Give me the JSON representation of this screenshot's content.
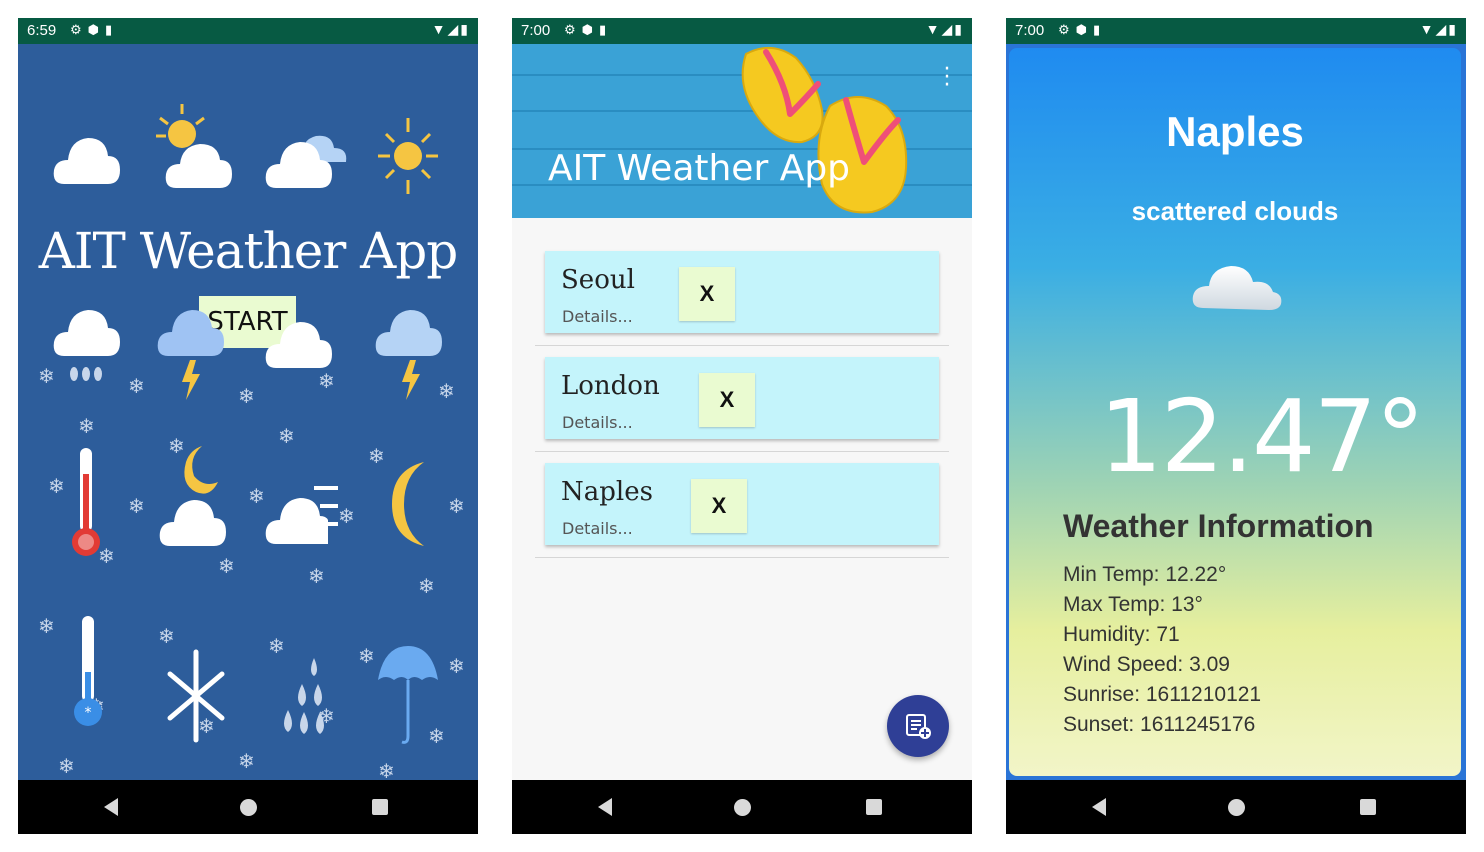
{
  "screen1": {
    "status": {
      "time": "6:59"
    },
    "title": "AIT Weather App",
    "start_label": "START"
  },
  "screen2": {
    "status": {
      "time": "7:00"
    },
    "appbar_title": "AIT Weather App",
    "cities": [
      {
        "name": "Seoul",
        "details": "Details...",
        "delete_label": "X"
      },
      {
        "name": "London",
        "details": "Details...",
        "delete_label": "X"
      },
      {
        "name": "Naples",
        "details": "Details...",
        "delete_label": "X"
      }
    ]
  },
  "screen3": {
    "status": {
      "time": "7:00"
    },
    "city": "Naples",
    "description": "scattered clouds",
    "temperature": "12.47°",
    "info_title": "Weather Information",
    "min_temp": "Min Temp: 12.22°",
    "max_temp": "Max Temp: 13°",
    "humidity": "Humidity: 71",
    "wind_speed": "Wind Speed: 3.09",
    "sunrise": "Sunrise: 1611210121",
    "sunset": "Sunset: 1611245176"
  },
  "colors": {
    "status_bar": "#075a43",
    "splash_bg": "#2d5d9b",
    "card_bg": "#c4f4fb",
    "button_bg": "#eafbd1",
    "fab_bg": "#2f3f96"
  }
}
